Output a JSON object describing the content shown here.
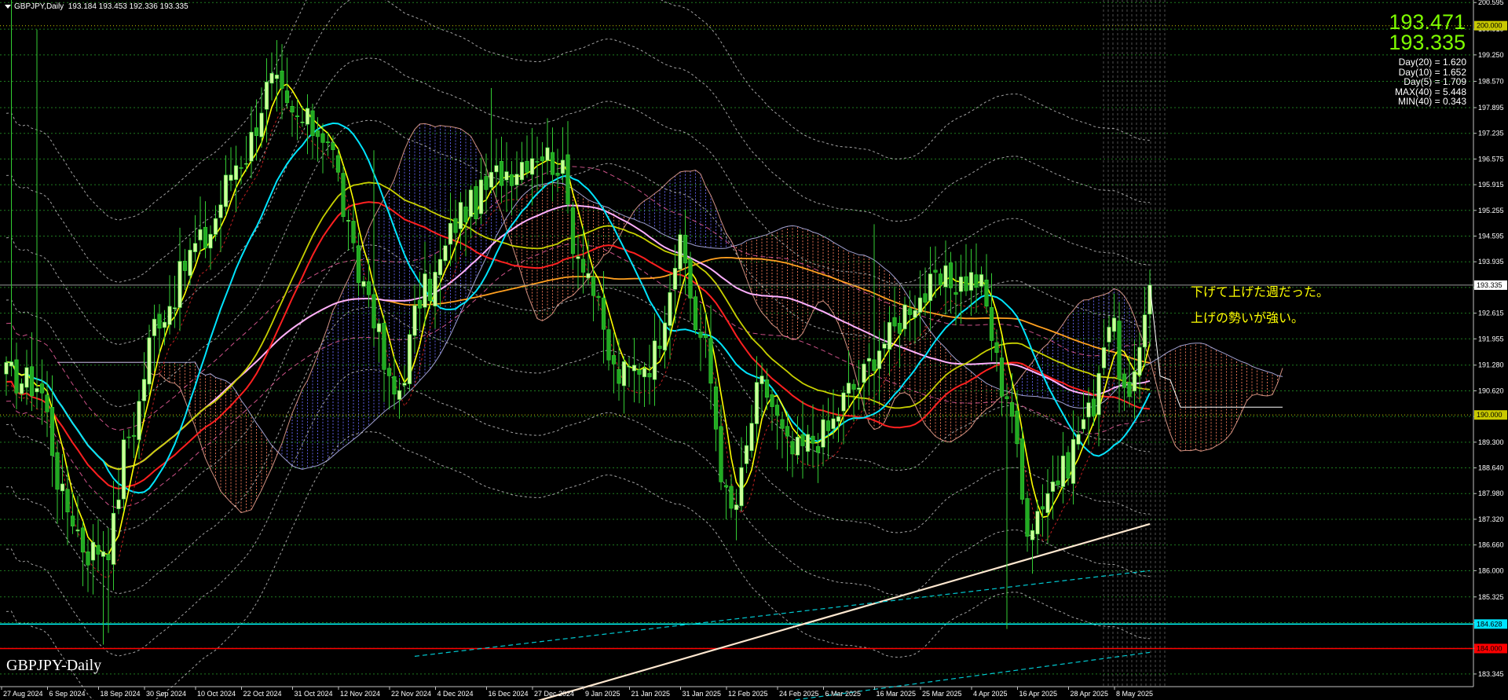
{
  "header": {
    "symbol": "GBPJPY,Daily",
    "ohlc": "193.184 193.453 192.336 193.335"
  },
  "price_panel": {
    "ask": "193.471",
    "bid": "193.335",
    "stats": [
      "Day(20) = 1.620",
      "Day(10) = 1.652",
      "Day(5) = 1.709",
      "MAX(40) = 5.448",
      "MIN(40) = 0.343"
    ]
  },
  "annotations": {
    "line1": "下げて上げた週だった。",
    "line2": "上げの勢いが強い。"
  },
  "title_bottom": "GBPJPY-Daily",
  "colors": {
    "background": "#000000",
    "bull_candle": "#ccff99",
    "bear_candle": "#22aa22",
    "ma_yellow": "#ffff00",
    "ma_cyan": "#00e5ff",
    "ma_red": "#ff2020",
    "ma_pink": "#ffb0ff",
    "ma_olive": "#c8d000",
    "ma_orange": "#ffa020",
    "trend_white": "#ffe8d0",
    "kumo_up": "#6a6aff",
    "kumo_down": "#ff8060",
    "hline_cyan": "#00ffff",
    "hline_red": "#ff0000",
    "price_green": "#7fff00"
  },
  "chart_data": {
    "type": "candlestick",
    "title": "GBPJPY-Daily",
    "xlabel": "",
    "ylabel": "",
    "ylim": [
      183.02,
      200.66
    ],
    "y_ticks": [
      "200.595",
      "199.910",
      "199.250",
      "198.570",
      "197.895",
      "197.235",
      "196.575",
      "195.915",
      "195.255",
      "194.595",
      "193.935",
      "193.275",
      "192.615",
      "191.955",
      "191.280",
      "190.620",
      "189.960",
      "189.300",
      "188.640",
      "187.980",
      "187.320",
      "186.660",
      "186.000",
      "185.325",
      "184.665",
      "184.005",
      "183.345"
    ],
    "x_ticks": [
      "27 Aug 2024",
      "6 Sep 2024",
      "18 Sep 2024",
      "30 Sep 2024",
      "10 Oct 2024",
      "22 Oct 2024",
      "31 Oct 2024",
      "12 Nov 2024",
      "22 Nov 2024",
      "4 Dec 2024",
      "16 Dec 2024",
      "27 Dec 2024",
      "9 Jan 2025",
      "21 Jan 2025",
      "31 Jan 2025",
      "12 Feb 2025",
      "24 Feb 2025",
      "6 Mar 2025",
      "16 Mar 2025",
      "25 Mar 2025",
      "4 Apr 2025",
      "16 Apr 2025",
      "28 Apr 2025",
      "8 May 2025"
    ],
    "price_labels": [
      {
        "value": 200.0,
        "text": "200.000",
        "color": "#c8c800"
      },
      {
        "value": 193.335,
        "text": "193.335",
        "color": "#ffffff"
      },
      {
        "value": 190.0,
        "text": "190.000",
        "color": "#c8c800"
      },
      {
        "value": 184.628,
        "text": "184.628",
        "color": "#00e5ff"
      },
      {
        "value": 184.0,
        "text": "184.000",
        "color": "#ff0000"
      }
    ],
    "levels": {
      "cyan_line": 184.628,
      "red_line": 184.0,
      "current": 193.335
    },
    "close_anchors": [
      [
        0,
        191.0
      ],
      [
        6,
        190.8
      ],
      [
        12,
        187.6
      ],
      [
        16,
        186.5
      ],
      [
        20,
        186.7
      ],
      [
        24,
        189.5
      ],
      [
        30,
        192.6
      ],
      [
        38,
        194.4
      ],
      [
        46,
        196.6
      ],
      [
        52,
        198.5
      ],
      [
        56,
        197.6
      ],
      [
        62,
        197.3
      ],
      [
        70,
        193.4
      ],
      [
        76,
        190.5
      ],
      [
        82,
        193.2
      ],
      [
        90,
        195.3
      ],
      [
        98,
        196.3
      ],
      [
        104,
        196.8
      ],
      [
        108,
        196.5
      ],
      [
        112,
        194.2
      ],
      [
        120,
        191.0
      ],
      [
        126,
        191.4
      ],
      [
        132,
        194.2
      ],
      [
        136,
        192.0
      ],
      [
        142,
        187.5
      ],
      [
        148,
        190.7
      ],
      [
        154,
        189.0
      ],
      [
        160,
        189.5
      ],
      [
        166,
        190.7
      ],
      [
        172,
        191.9
      ],
      [
        178,
        193.0
      ],
      [
        184,
        193.4
      ],
      [
        190,
        193.5
      ],
      [
        196,
        190.6
      ],
      [
        200,
        187.3
      ],
      [
        206,
        188.4
      ],
      [
        212,
        190.0
      ],
      [
        216,
        192.4
      ],
      [
        220,
        190.2
      ],
      [
        224,
        193.3
      ]
    ]
  }
}
